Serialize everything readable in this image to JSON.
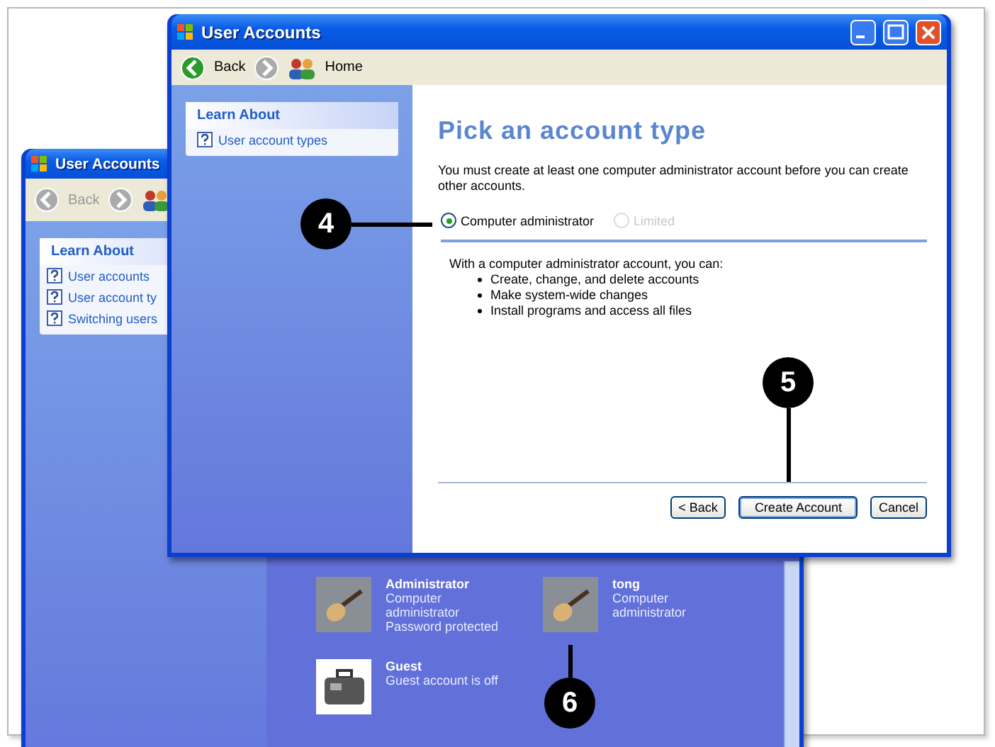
{
  "back_window": {
    "title": "User Accounts",
    "toolbar": {
      "back": "Back"
    },
    "learn_about": {
      "heading": "Learn About",
      "items": [
        "User accounts",
        "User account ty",
        "Switching users"
      ]
    },
    "accounts": [
      {
        "kind": "guitar",
        "name": "Administrator",
        "details": [
          "Computer administrator",
          "Password protected"
        ]
      },
      {
        "kind": "guitar",
        "name": "tong",
        "details": [
          "Computer administrator"
        ]
      },
      {
        "kind": "suitcase",
        "name": "Guest",
        "details": [
          "Guest account is off"
        ]
      }
    ]
  },
  "front_window": {
    "title": "User Accounts",
    "toolbar": {
      "back": "Back",
      "home": "Home"
    },
    "learn_about": {
      "heading": "Learn About",
      "items": [
        "User account types"
      ]
    },
    "heading": "Pick an account type",
    "intro": "You must create at least one computer administrator account before you can create other accounts.",
    "options": [
      {
        "label": "Computer administrator",
        "selected": true,
        "disabled": false
      },
      {
        "label": "Limited",
        "selected": false,
        "disabled": true
      }
    ],
    "summary": "With a computer administrator account, you can:",
    "bullets": [
      "Create, change, and delete accounts",
      "Make system-wide changes",
      "Install programs and access all files"
    ],
    "buttons": [
      {
        "label": "< Back",
        "default": false
      },
      {
        "label": "Create Account",
        "default": true
      },
      {
        "label": "Cancel",
        "default": false
      }
    ]
  },
  "callouts": [
    {
      "number": "4"
    },
    {
      "number": "5"
    },
    {
      "number": "6"
    }
  ]
}
